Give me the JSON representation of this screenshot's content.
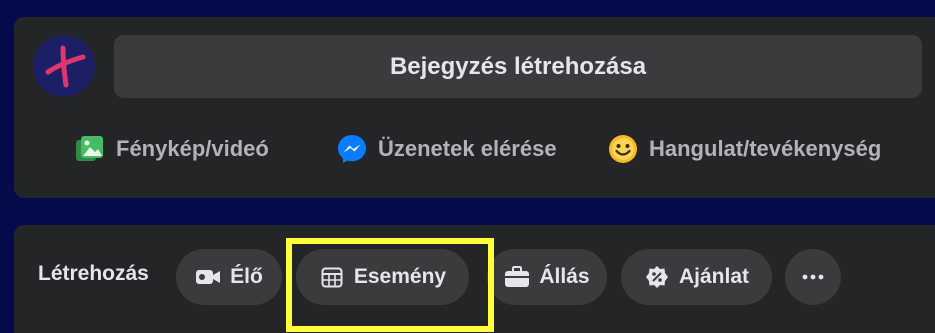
{
  "composer": {
    "post_prompt": "Bejegyzés létrehozása",
    "actions": [
      {
        "label": "Fénykép/videó",
        "icon": "photo-video-icon",
        "color": "#45bd62"
      },
      {
        "label": "Üzenetek elérése",
        "icon": "messenger-icon",
        "color": "#0a7cff"
      },
      {
        "label": "Hangulat/tevékenység",
        "icon": "smiley-icon",
        "color": "#f7b928"
      }
    ]
  },
  "create": {
    "label": "Létrehozás",
    "items": [
      {
        "label": "Élő",
        "icon": "video-camera-icon"
      },
      {
        "label": "Esemény",
        "icon": "calendar-icon"
      },
      {
        "label": "Állás",
        "icon": "briefcase-icon"
      },
      {
        "label": "Ajánlat",
        "icon": "offer-tag-icon"
      },
      {
        "label": "",
        "icon": "more-icon"
      }
    ]
  },
  "highlight": {
    "target": "Esemény",
    "color": "#ffff3a"
  },
  "colors": {
    "background": "#050a4a",
    "panel": "#242526",
    "surface": "#3a3b3c",
    "text": "#e4e6eb",
    "muted": "#b0b3b8"
  }
}
